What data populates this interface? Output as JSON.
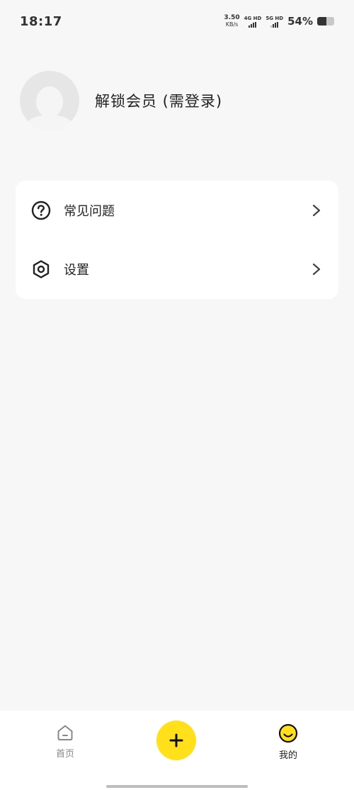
{
  "status_bar": {
    "time": "18:17",
    "net_speed_value": "3.50",
    "net_speed_unit": "KB/s",
    "sim1_label": "4G HD",
    "sim2_label": "5G HD",
    "battery_percent": "54%",
    "battery_level": 0.54
  },
  "profile": {
    "name": "解锁会员 (需登录)"
  },
  "menu": {
    "items": [
      {
        "label": "常见问题",
        "icon": "help-circle-icon"
      },
      {
        "label": "设置",
        "icon": "settings-hex-icon"
      }
    ]
  },
  "bottom_nav": {
    "home_label": "首页",
    "add_icon": "plus-icon",
    "mine_label": "我的"
  },
  "colors": {
    "accent": "#ffe01a",
    "background": "#f7f7f7",
    "card": "#ffffff",
    "text": "#222222",
    "muted": "#888888"
  }
}
